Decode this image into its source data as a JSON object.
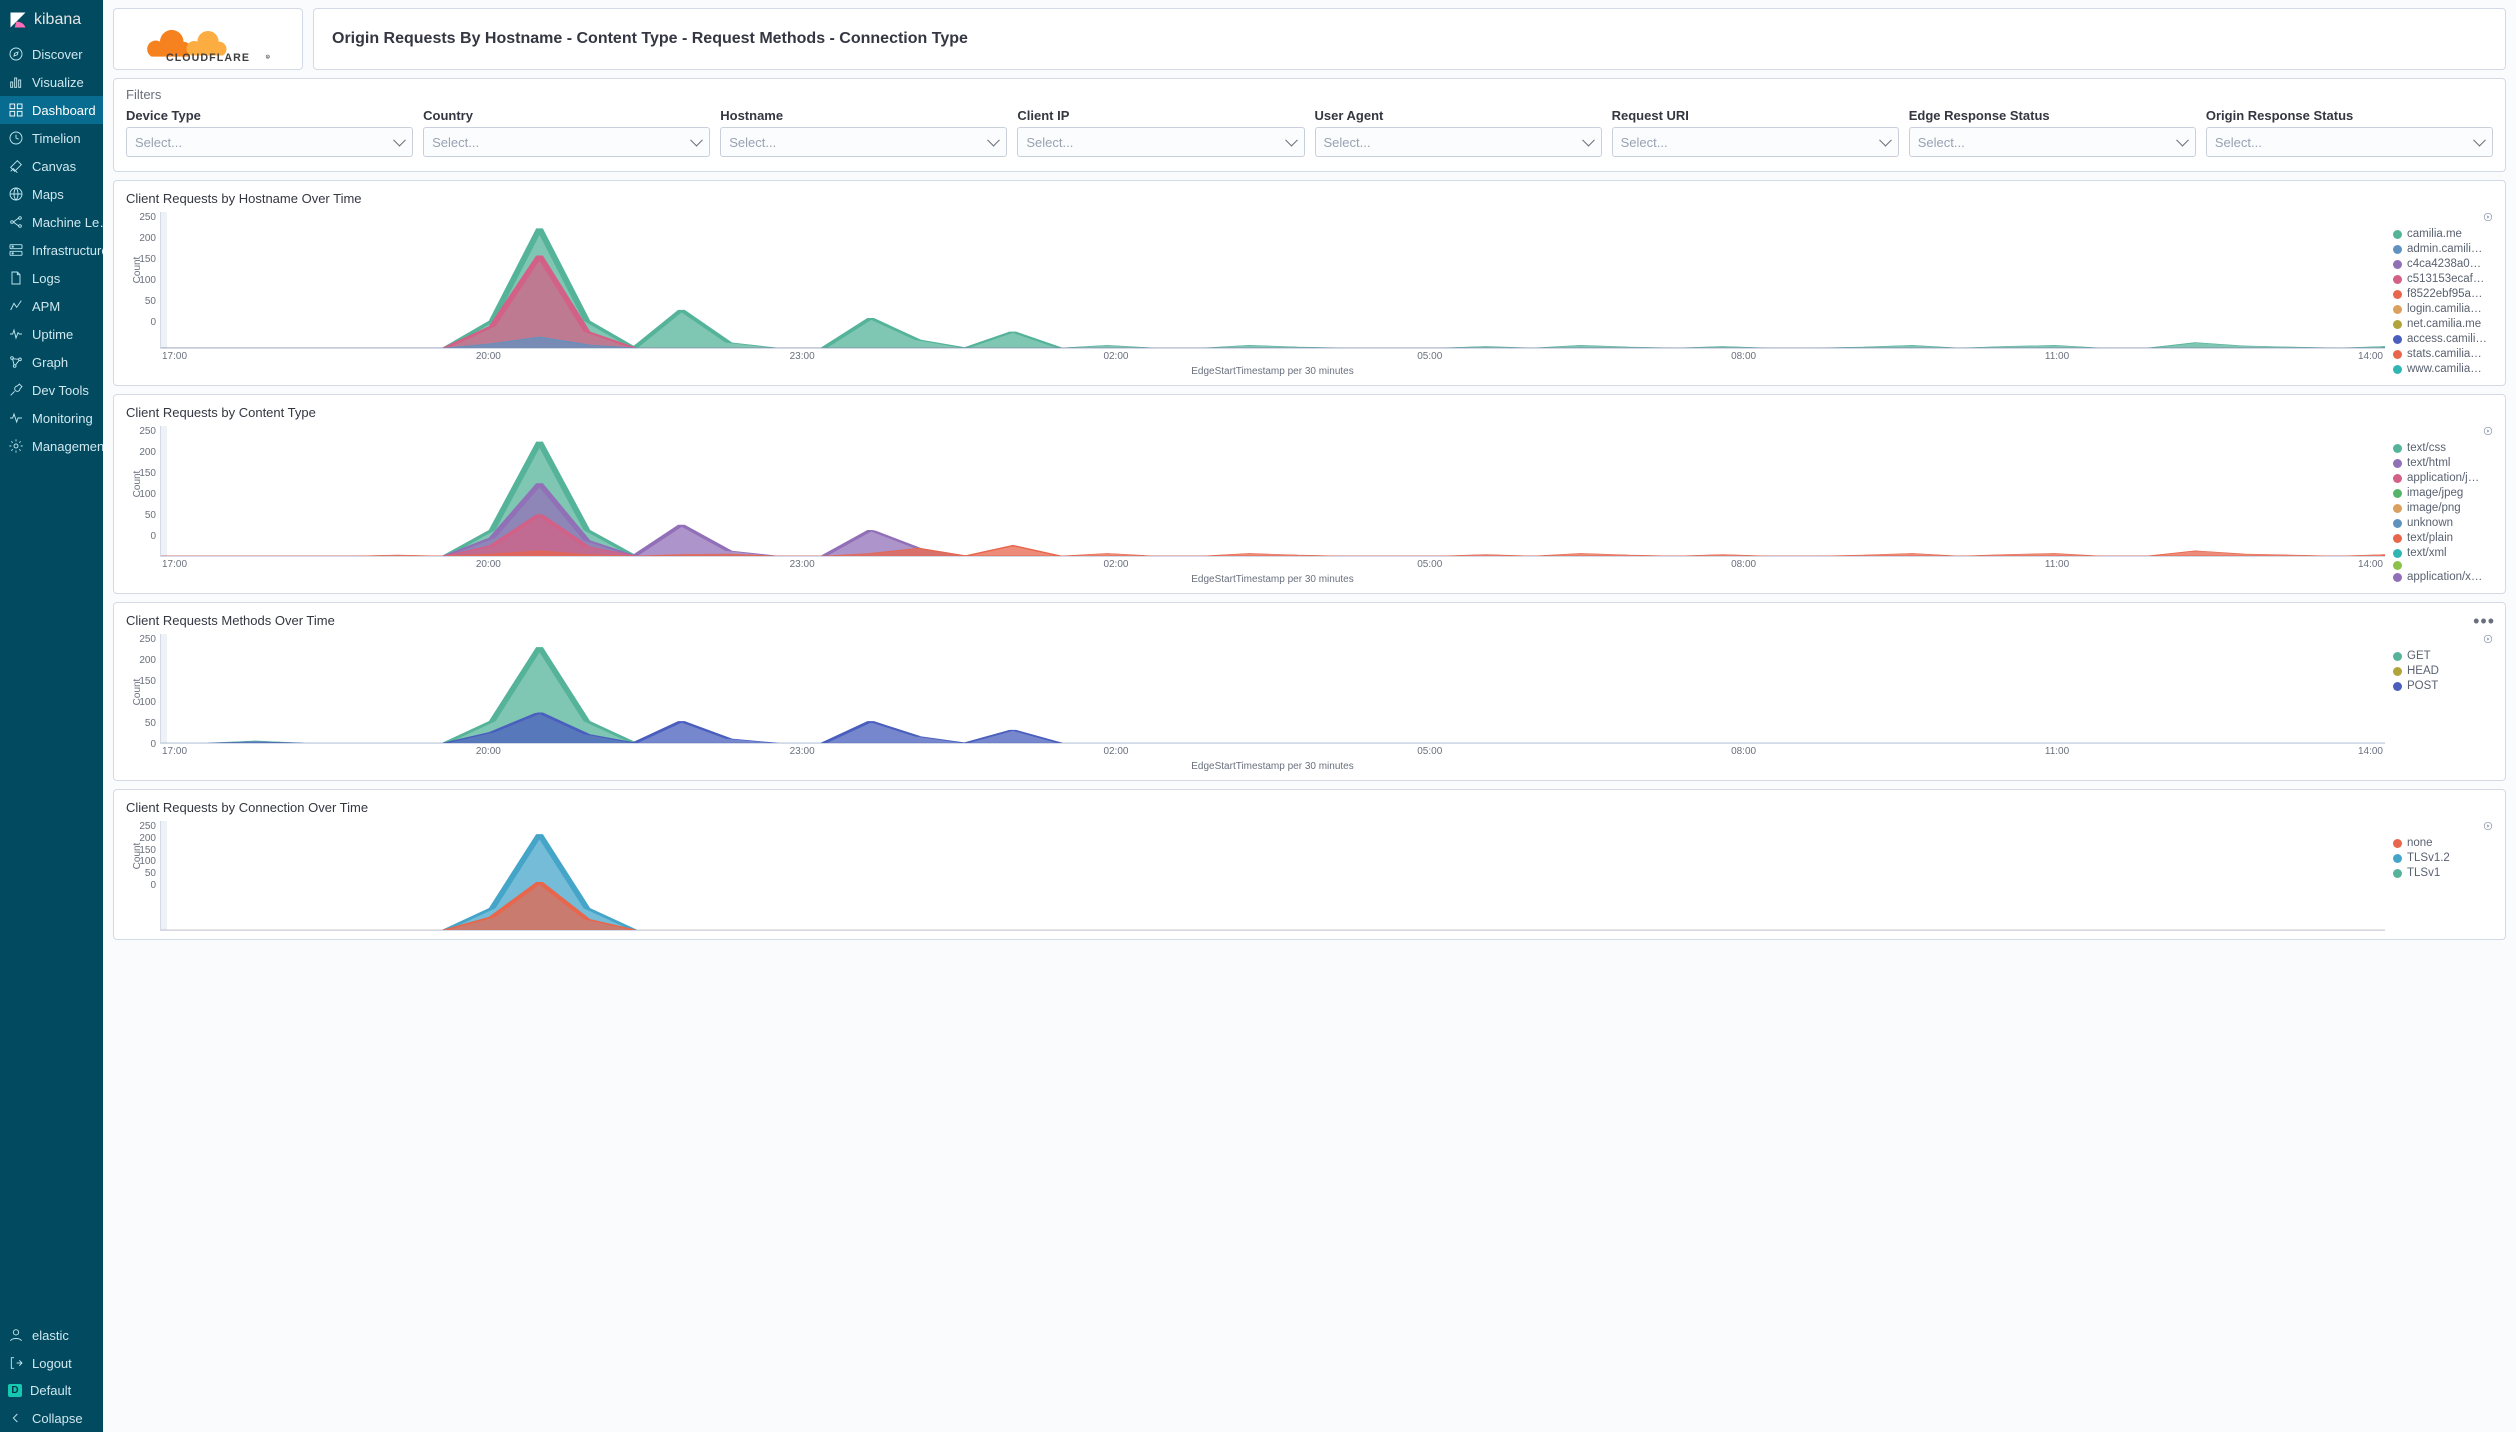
{
  "app_name": "kibana",
  "sidebar": {
    "items": [
      {
        "label": "Discover",
        "icon": "compass"
      },
      {
        "label": "Visualize",
        "icon": "bar"
      },
      {
        "label": "Dashboard",
        "icon": "grid",
        "active": true
      },
      {
        "label": "Timelion",
        "icon": "clock"
      },
      {
        "label": "Canvas",
        "icon": "brush"
      },
      {
        "label": "Maps",
        "icon": "globe"
      },
      {
        "label": "Machine Le…",
        "icon": "ml"
      },
      {
        "label": "Infrastructure",
        "icon": "server"
      },
      {
        "label": "Logs",
        "icon": "file"
      },
      {
        "label": "APM",
        "icon": "apm"
      },
      {
        "label": "Uptime",
        "icon": "heartbeat"
      },
      {
        "label": "Graph",
        "icon": "graph"
      },
      {
        "label": "Dev Tools",
        "icon": "wrench"
      },
      {
        "label": "Monitoring",
        "icon": "pulse"
      },
      {
        "label": "Management",
        "icon": "gear"
      }
    ],
    "footer": [
      {
        "label": "elastic",
        "icon": "user"
      },
      {
        "label": "Logout",
        "icon": "logout"
      },
      {
        "label": "Default",
        "icon": "default",
        "badge": "D"
      },
      {
        "label": "Collapse",
        "icon": "collapse"
      }
    ]
  },
  "page_title": "Origin Requests By Hostname - Content Type - Request Methods - Connection Type",
  "filters": {
    "title": "Filters",
    "placeholder": "Select...",
    "labels": [
      "Device Type",
      "Country",
      "Hostname",
      "Client IP",
      "User Agent",
      "Request URI",
      "Edge Response Status",
      "Origin Response Status"
    ]
  },
  "colors": {
    "green": "#54b399",
    "olive": "#b0a43a",
    "blue": "#6092c0",
    "purple": "#9170b8",
    "magenta": "#d36086",
    "red": "#e7664c",
    "orange": "#daa05d",
    "teal": "#2fb6b2",
    "navy": "#4a5fbd"
  },
  "charts": [
    {
      "id": "hostname",
      "title": "Client Requests by Hostname Over Time",
      "legend": [
        {
          "label": "camilia.me",
          "color": "#54b399"
        },
        {
          "label": "admin.camili…",
          "color": "#6092c0"
        },
        {
          "label": "c4ca4238a0…",
          "color": "#9170b8"
        },
        {
          "label": "c513153ecaf…",
          "color": "#d36086"
        },
        {
          "label": "f8522ebf95a…",
          "color": "#e7664c"
        },
        {
          "label": "login.camilia…",
          "color": "#daa05d"
        },
        {
          "label": "net.camilia.me",
          "color": "#b0a43a"
        },
        {
          "label": "access.camili…",
          "color": "#4a5fbd"
        },
        {
          "label": "stats.camilia…",
          "color": "#e7664c"
        },
        {
          "label": "www.camilia…",
          "color": "#2fb6b2"
        }
      ]
    },
    {
      "id": "content",
      "title": "Client Requests by Content Type",
      "legend": [
        {
          "label": "text/css",
          "color": "#54b399"
        },
        {
          "label": "text/html",
          "color": "#9170b8"
        },
        {
          "label": "application/j…",
          "color": "#d36086"
        },
        {
          "label": "image/jpeg",
          "color": "#55b36a"
        },
        {
          "label": "image/png",
          "color": "#daa05d"
        },
        {
          "label": "unknown",
          "color": "#6092c0"
        },
        {
          "label": "text/plain",
          "color": "#e7664c"
        },
        {
          "label": "text/xml",
          "color": "#2fb6b2"
        },
        {
          "label": "",
          "color": "#8bc34a"
        },
        {
          "label": "application/x…",
          "color": "#9170b8"
        }
      ]
    },
    {
      "id": "methods",
      "title": "Client Requests Methods Over Time",
      "more": true,
      "legend": [
        {
          "label": "GET",
          "color": "#54b399"
        },
        {
          "label": "HEAD",
          "color": "#b0a43a"
        },
        {
          "label": "POST",
          "color": "#4a5fbd"
        }
      ]
    },
    {
      "id": "connection",
      "title": "Client Requests by Connection Over Time",
      "partial": true,
      "legend": [
        {
          "label": "none",
          "color": "#e7664c"
        },
        {
          "label": "TLSv1.2",
          "color": "#45a5c9"
        },
        {
          "label": "TLSv1",
          "color": "#54b399"
        }
      ]
    }
  ],
  "chart_data": [
    {
      "type": "area",
      "title": "Client Requests by Hostname Over Time",
      "xlabel": "EdgeStartTimestamp per 30 minutes",
      "ylabel": "Count",
      "ylim": [
        0,
        250
      ],
      "y_ticks": [
        0,
        50,
        100,
        150,
        200,
        250
      ],
      "x_ticks": [
        "17:00",
        "20:00",
        "23:00",
        "02:00",
        "05:00",
        "08:00",
        "11:00",
        "14:00"
      ],
      "series": [
        {
          "name": "camilia.me",
          "color": "#54b399",
          "values": [
            0,
            0,
            0,
            0,
            0,
            0,
            0,
            50,
            220,
            50,
            0,
            70,
            10,
            0,
            0,
            55,
            15,
            0,
            30,
            0,
            5,
            0,
            0,
            5,
            2,
            0,
            0,
            0,
            3,
            0,
            5,
            2,
            0,
            3,
            0,
            0,
            2,
            5,
            0,
            3,
            5,
            0,
            0,
            10,
            4,
            2,
            0,
            3
          ]
        },
        {
          "name": "c513153ecaf",
          "color": "#d36086",
          "values": [
            0,
            0,
            0,
            0,
            0,
            0,
            0,
            40,
            170,
            30,
            0,
            0,
            0,
            0,
            0,
            0,
            0,
            0,
            0,
            0,
            0,
            0,
            0,
            0,
            0,
            0,
            0,
            0,
            0,
            0,
            0,
            0,
            0,
            0,
            0,
            0,
            0,
            0,
            0,
            0,
            0,
            0,
            0,
            0,
            0,
            0,
            0,
            0
          ]
        },
        {
          "name": "admin.camili",
          "color": "#6092c0",
          "values": [
            0,
            0,
            0,
            0,
            0,
            0,
            0,
            8,
            20,
            6,
            0,
            0,
            0,
            0,
            0,
            0,
            0,
            0,
            0,
            0,
            0,
            0,
            0,
            0,
            0,
            0,
            0,
            0,
            0,
            0,
            0,
            0,
            0,
            0,
            0,
            0,
            0,
            0,
            0,
            0,
            0,
            0,
            0,
            0,
            0,
            0,
            0,
            0
          ]
        }
      ]
    },
    {
      "type": "area",
      "title": "Client Requests by Content Type",
      "xlabel": "EdgeStartTimestamp per 30 minutes",
      "ylabel": "Count",
      "ylim": [
        0,
        250
      ],
      "y_ticks": [
        0,
        50,
        100,
        150,
        200,
        250
      ],
      "x_ticks": [
        "17:00",
        "20:00",
        "23:00",
        "02:00",
        "05:00",
        "08:00",
        "11:00",
        "14:00"
      ],
      "series": [
        {
          "name": "text/css",
          "color": "#54b399",
          "values": [
            0,
            0,
            0,
            0,
            0,
            0,
            0,
            50,
            220,
            50,
            0,
            0,
            0,
            0,
            0,
            0,
            0,
            0,
            0,
            0,
            0,
            0,
            0,
            0,
            0,
            0,
            0,
            0,
            0,
            0,
            0,
            0,
            0,
            0,
            0,
            0,
            0,
            0,
            0,
            0,
            0,
            0,
            0,
            0,
            0,
            0,
            0,
            0
          ]
        },
        {
          "name": "text/html",
          "color": "#9170b8",
          "values": [
            0,
            0,
            0,
            0,
            0,
            0,
            0,
            35,
            140,
            30,
            0,
            60,
            10,
            0,
            0,
            50,
            15,
            0,
            0,
            0,
            0,
            0,
            0,
            0,
            0,
            0,
            0,
            0,
            0,
            0,
            0,
            0,
            0,
            0,
            0,
            0,
            0,
            0,
            0,
            0,
            0,
            0,
            0,
            0,
            0,
            0,
            0,
            0
          ]
        },
        {
          "name": "application/j",
          "color": "#d36086",
          "values": [
            0,
            0,
            0,
            0,
            0,
            0,
            0,
            20,
            80,
            18,
            0,
            0,
            0,
            0,
            0,
            0,
            0,
            0,
            0,
            0,
            0,
            0,
            0,
            0,
            0,
            0,
            0,
            0,
            0,
            0,
            0,
            0,
            0,
            0,
            0,
            0,
            0,
            0,
            0,
            0,
            0,
            0,
            0,
            0,
            0,
            0,
            0,
            0
          ]
        },
        {
          "name": "text/plain",
          "color": "#e7664c",
          "values": [
            0,
            0,
            0,
            0,
            0,
            2,
            0,
            4,
            10,
            3,
            0,
            3,
            4,
            0,
            0,
            5,
            15,
            0,
            20,
            0,
            5,
            0,
            0,
            5,
            2,
            0,
            0,
            0,
            3,
            0,
            5,
            2,
            0,
            3,
            0,
            0,
            2,
            5,
            0,
            3,
            5,
            0,
            0,
            10,
            4,
            2,
            0,
            3
          ]
        }
      ]
    },
    {
      "type": "area",
      "title": "Client Requests Methods Over Time",
      "xlabel": "EdgeStartTimestamp per 30 minutes",
      "ylabel": "Count",
      "ylim": [
        0,
        250
      ],
      "y_ticks": [
        0,
        50,
        100,
        150,
        200,
        250
      ],
      "x_ticks": [
        "17:00",
        "20:00",
        "23:00",
        "02:00",
        "05:00",
        "08:00",
        "11:00",
        "14:00"
      ],
      "series": [
        {
          "name": "GET",
          "color": "#54b399",
          "values": [
            0,
            0,
            5,
            0,
            0,
            0,
            0,
            50,
            220,
            50,
            0,
            0,
            0,
            0,
            0,
            0,
            0,
            0,
            0,
            0,
            0,
            0,
            0,
            0,
            0,
            0,
            0,
            0,
            0,
            0,
            0,
            0,
            0,
            0,
            0,
            0,
            0,
            0,
            0,
            0,
            0,
            0,
            0,
            0,
            0,
            0,
            0,
            0
          ]
        },
        {
          "name": "POST",
          "color": "#4a5fbd",
          "values": [
            0,
            0,
            3,
            0,
            0,
            0,
            0,
            25,
            70,
            20,
            0,
            50,
            10,
            0,
            0,
            50,
            15,
            0,
            30,
            0,
            0,
            0,
            0,
            0,
            0,
            0,
            0,
            0,
            0,
            0,
            0,
            0,
            0,
            0,
            0,
            0,
            0,
            0,
            0,
            0,
            0,
            0,
            0,
            0,
            0,
            0,
            0,
            0
          ]
        }
      ]
    },
    {
      "type": "area",
      "title": "Client Requests by Connection Over Time",
      "xlabel": "EdgeStartTimestamp per 30 minutes",
      "ylabel": "Count",
      "ylim": [
        0,
        250
      ],
      "y_ticks": [
        0,
        50,
        100,
        150,
        200,
        250
      ],
      "x_ticks": [
        "17:00",
        "20:00",
        "23:00",
        "02:00",
        "05:00",
        "08:00",
        "11:00",
        "14:00"
      ],
      "series": [
        {
          "name": "TLSv1.2",
          "color": "#45a5c9",
          "values": [
            0,
            0,
            0,
            0,
            0,
            0,
            0,
            50,
            220,
            50,
            0,
            0,
            0,
            0,
            0,
            0,
            0,
            0,
            0,
            0,
            0,
            0,
            0,
            0,
            0,
            0,
            0,
            0,
            0,
            0,
            0,
            0,
            0,
            0,
            0,
            0,
            0,
            0,
            0,
            0,
            0,
            0,
            0,
            0,
            0,
            0,
            0,
            0
          ]
        },
        {
          "name": "none",
          "color": "#e7664c",
          "values": [
            0,
            0,
            0,
            0,
            0,
            0,
            0,
            30,
            110,
            25,
            0,
            0,
            0,
            0,
            0,
            0,
            0,
            0,
            0,
            0,
            0,
            0,
            0,
            0,
            0,
            0,
            0,
            0,
            0,
            0,
            0,
            0,
            0,
            0,
            0,
            0,
            0,
            0,
            0,
            0,
            0,
            0,
            0,
            0,
            0,
            0,
            0,
            0
          ]
        }
      ]
    }
  ]
}
